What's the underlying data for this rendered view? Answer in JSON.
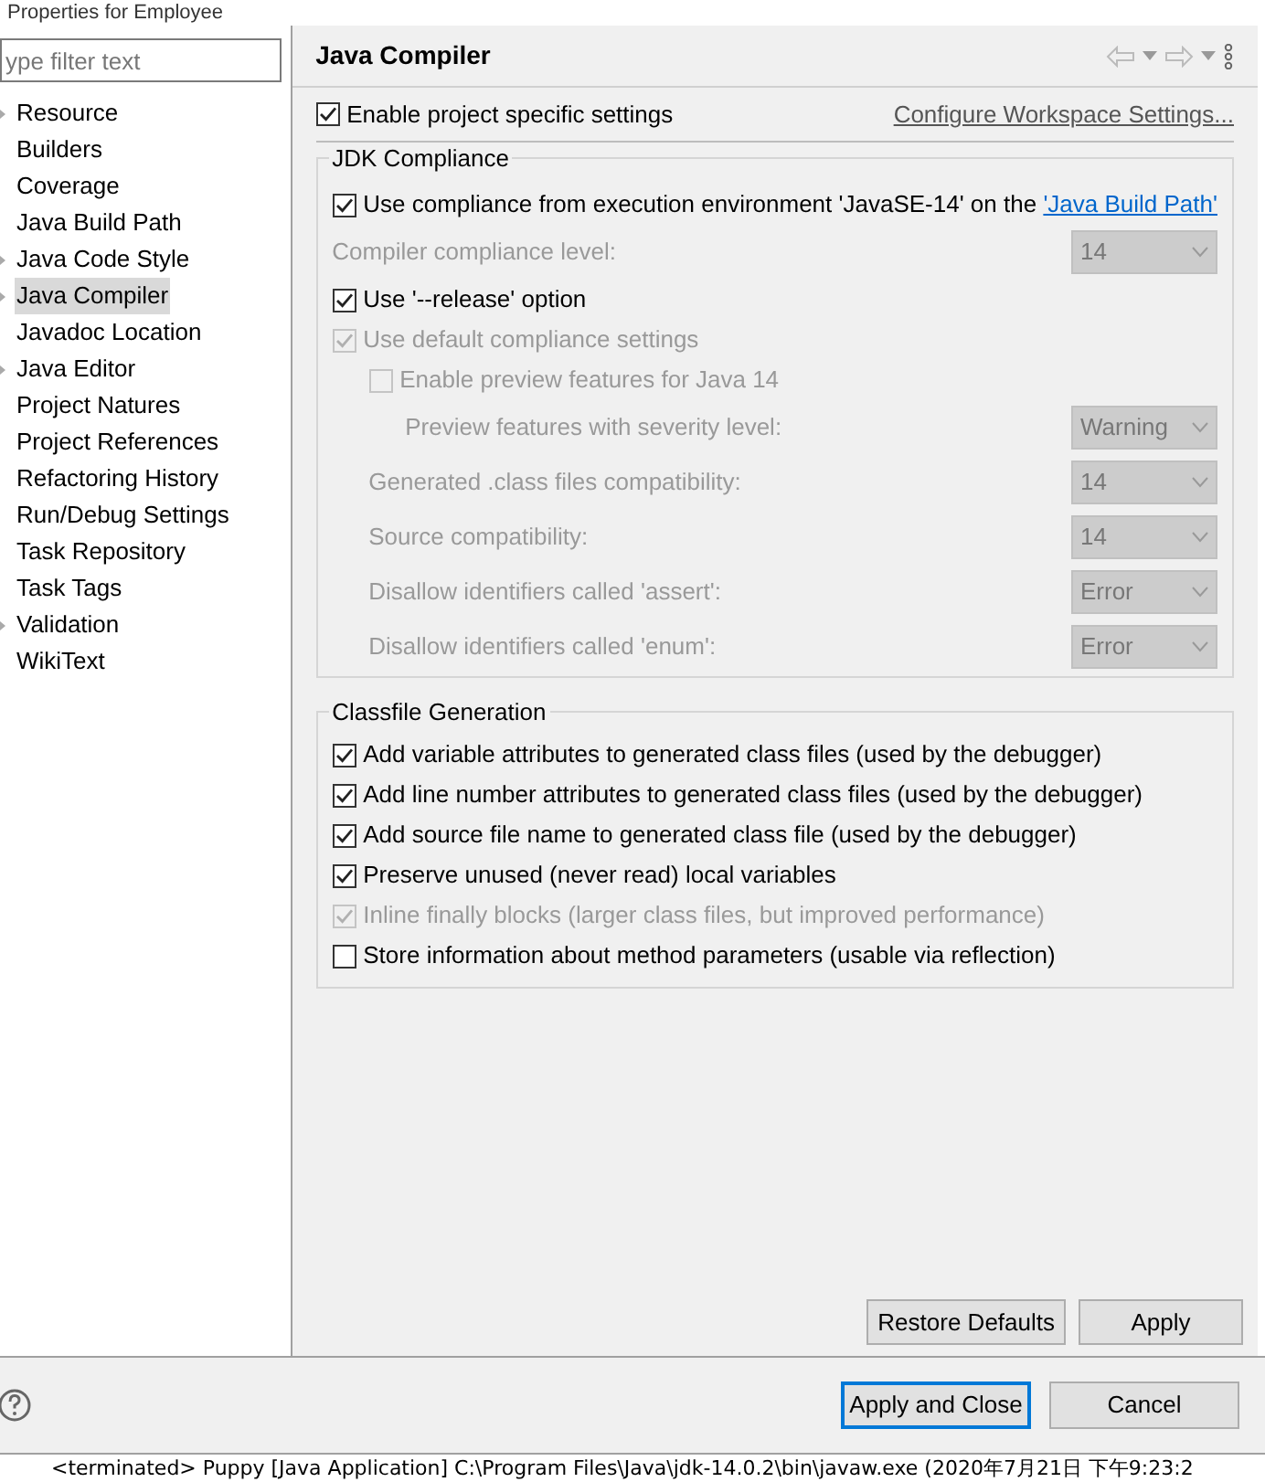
{
  "window": {
    "title": "Properties for Employee"
  },
  "filter": {
    "placeholder": "ype filter text"
  },
  "sidebar": {
    "items": [
      {
        "label": "Resource",
        "expandable": true,
        "selected": false
      },
      {
        "label": "Builders",
        "expandable": false,
        "selected": false
      },
      {
        "label": "Coverage",
        "expandable": false,
        "selected": false
      },
      {
        "label": "Java Build Path",
        "expandable": false,
        "selected": false
      },
      {
        "label": "Java Code Style",
        "expandable": true,
        "selected": false
      },
      {
        "label": "Java Compiler",
        "expandable": true,
        "selected": true
      },
      {
        "label": "Javadoc Location",
        "expandable": false,
        "selected": false
      },
      {
        "label": "Java Editor",
        "expandable": true,
        "selected": false
      },
      {
        "label": "Project Natures",
        "expandable": false,
        "selected": false
      },
      {
        "label": "Project References",
        "expandable": false,
        "selected": false
      },
      {
        "label": "Refactoring History",
        "expandable": false,
        "selected": false
      },
      {
        "label": "Run/Debug Settings",
        "expandable": false,
        "selected": false
      },
      {
        "label": "Task Repository",
        "expandable": false,
        "selected": false
      },
      {
        "label": "Task Tags",
        "expandable": false,
        "selected": false
      },
      {
        "label": "Validation",
        "expandable": true,
        "selected": false
      },
      {
        "label": "WikiText",
        "expandable": false,
        "selected": false
      }
    ]
  },
  "page": {
    "title": "Java Compiler",
    "enable": {
      "label": "Enable project specific settings",
      "checked": true
    },
    "configure_link": "Configure Workspace Settings...",
    "jdk_group": {
      "title": "JDK Compliance",
      "use_compliance": {
        "label": "Use compliance from execution environment 'JavaSE-14' on the ",
        "link": "'Java Build Path'",
        "checked": true
      },
      "rows": [
        {
          "kind": "select",
          "label": "Compiler compliance level:",
          "value": "14",
          "disabled": true
        },
        {
          "kind": "checkbox",
          "label": "Use '--release' option",
          "checked": true,
          "disabled": false
        },
        {
          "kind": "checkbox",
          "label": "Use default compliance settings",
          "checked": true,
          "disabled": true,
          "children": [
            {
              "kind": "checkbox",
              "label": "Enable preview features for Java 14",
              "checked": false,
              "disabled": true,
              "children": [
                {
                  "kind": "select",
                  "label": "Preview features with severity level:",
                  "value": "Warning",
                  "disabled": true
                }
              ]
            },
            {
              "kind": "select",
              "label": "Generated .class files compatibility:",
              "value": "14",
              "disabled": true
            },
            {
              "kind": "select",
              "label": "Source compatibility:",
              "value": "14",
              "disabled": true
            },
            {
              "kind": "select",
              "label": "Disallow identifiers called 'assert':",
              "value": "Error",
              "disabled": true
            },
            {
              "kind": "select",
              "label": "Disallow identifiers called 'enum':",
              "value": "Error",
              "disabled": true
            }
          ]
        }
      ]
    },
    "classfile_group": {
      "title": "Classfile Generation",
      "rows": [
        {
          "label": "Add variable attributes to generated class files (used by the debugger)",
          "checked": true,
          "disabled": false
        },
        {
          "label": "Add line number attributes to generated class files (used by the debugger)",
          "checked": true,
          "disabled": false
        },
        {
          "label": "Add source file name to generated class file (used by the debugger)",
          "checked": true,
          "disabled": false
        },
        {
          "label": "Preserve unused (never read) local variables",
          "checked": true,
          "disabled": false
        },
        {
          "label": "Inline finally blocks (larger class files, but improved performance)",
          "checked": true,
          "disabled": true
        },
        {
          "label": "Store information about method parameters (usable via reflection)",
          "checked": false,
          "disabled": false
        }
      ]
    },
    "buttons": [
      "Restore Defaults",
      "Apply"
    ]
  },
  "dialog_buttons": [
    {
      "label": "Apply and Close",
      "default": true
    },
    {
      "label": "Cancel",
      "default": false
    }
  ],
  "console_line": "<terminated> Puppy [Java Application] C:\\Program Files\\Java\\jdk-14.0.2\\bin\\javaw.exe (2020年7月21日 下午9:23:2"
}
